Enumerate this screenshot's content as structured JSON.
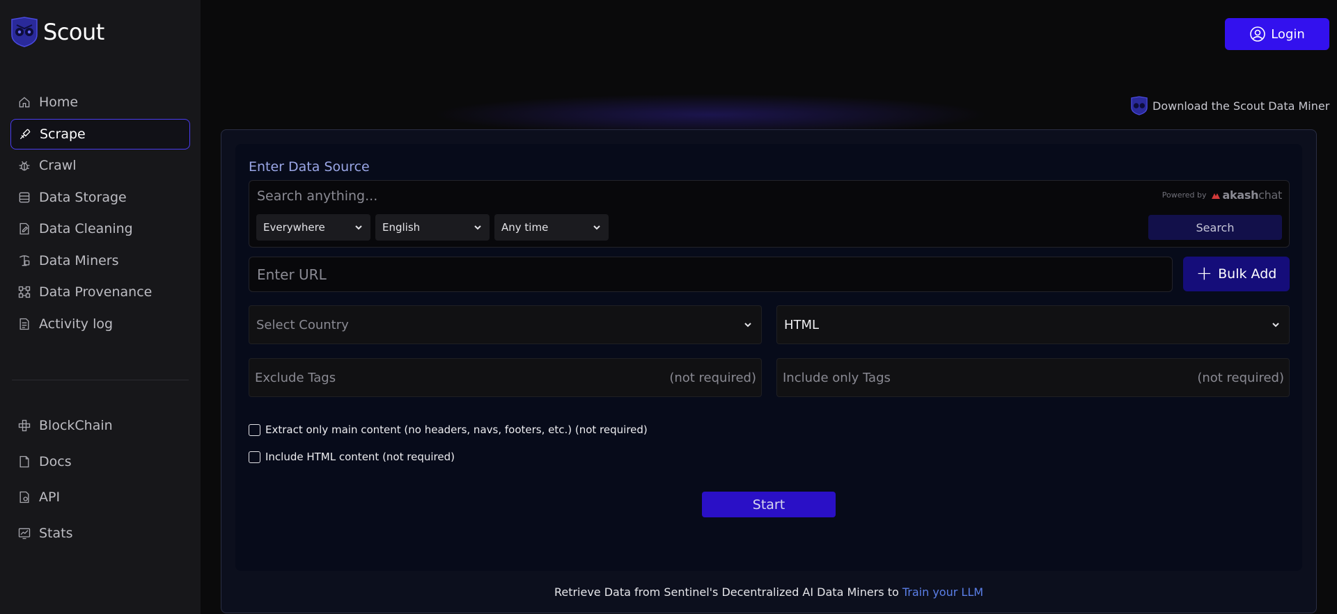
{
  "app": {
    "name": "Scout"
  },
  "sidebar": {
    "items": [
      {
        "label": "Home",
        "icon": "home-icon"
      },
      {
        "label": "Scrape",
        "icon": "scrape-icon",
        "active": true
      },
      {
        "label": "Crawl",
        "icon": "bug-icon"
      },
      {
        "label": "Data Storage",
        "icon": "database-icon"
      },
      {
        "label": "Data Cleaning",
        "icon": "edit-document-icon"
      },
      {
        "label": "Data Miners",
        "icon": "miner-icon"
      },
      {
        "label": "Data Provenance",
        "icon": "provenance-icon"
      },
      {
        "label": "Activity log",
        "icon": "log-icon"
      }
    ],
    "bottom_items": [
      {
        "label": "BlockChain",
        "icon": "blockchain-icon"
      },
      {
        "label": "Docs",
        "icon": "document-icon"
      },
      {
        "label": "API",
        "icon": "api-icon"
      },
      {
        "label": "Stats",
        "icon": "chart-icon"
      }
    ]
  },
  "header": {
    "login_label": "Login",
    "download_label": "Download the Scout Data Miner"
  },
  "form": {
    "title": "Enter Data Source",
    "search": {
      "placeholder": "Search anything...",
      "powered_by": "Powered by",
      "brand_bold": "akash",
      "brand_light": "chat",
      "filters": [
        "Everywhere",
        "English",
        "Any time"
      ],
      "button_label": "Search"
    },
    "url_placeholder": "Enter URL",
    "bulk_add_label": "Bulk Add",
    "country_placeholder": "Select Country",
    "format_value": "HTML",
    "exclude_tags": {
      "label": "Exclude Tags",
      "hint": "(not required)"
    },
    "include_tags": {
      "label": "Include only Tags",
      "hint": "(not required)"
    },
    "checkboxes": [
      {
        "label": "Extract only main content (no headers, navs, footers, etc.) (not required)",
        "checked": false
      },
      {
        "label": "Include HTML content (not required)",
        "checked": false
      }
    ],
    "start_label": "Start"
  },
  "footer": {
    "text": "Retrieve Data from Sentinel's Decentralized AI Data Miners to",
    "link": "Train your LLM"
  },
  "colors": {
    "accent": "#3311ee",
    "active_border": "#4a3df0",
    "link": "#5b7fe8"
  }
}
